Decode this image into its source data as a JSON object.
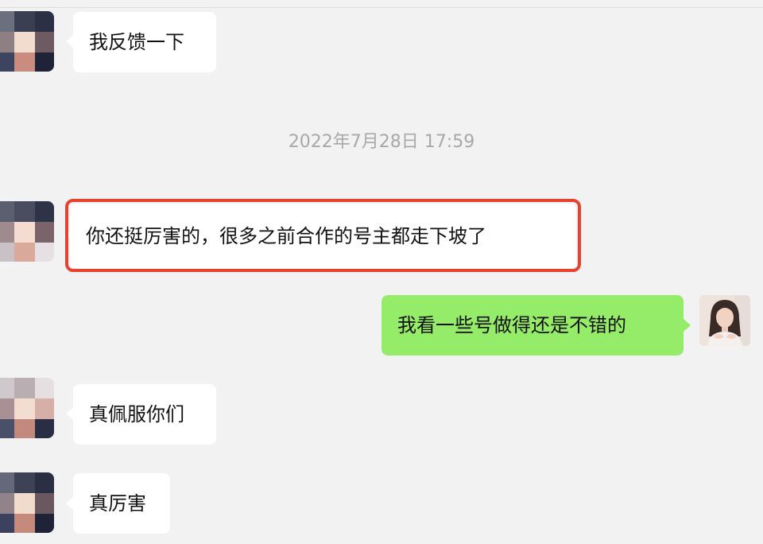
{
  "messages": [
    {
      "id": "m1",
      "direction": "in",
      "text": "我反馈一下"
    },
    {
      "id": "m2",
      "direction": "in",
      "text": "你还挺厉害的，很多之前合作的号主都走下坡了",
      "highlighted": true
    },
    {
      "id": "m3",
      "direction": "out",
      "text": "我看一些号做得还是不错的"
    },
    {
      "id": "m4",
      "direction": "in",
      "text": "真佩服你们"
    },
    {
      "id": "m5",
      "direction": "in",
      "text": "真厉害"
    }
  ],
  "timestamp": "2022年7月28日 17:59",
  "colors": {
    "background": "#f2f2f2",
    "incoming_bubble": "#ffffff",
    "outgoing_bubble": "#95ec69",
    "highlight_border": "#e5432f",
    "timestamp_text": "#a8a8a8"
  },
  "avatars": {
    "contact": "pixelated-avatar",
    "self": "user-photo-avatar"
  }
}
